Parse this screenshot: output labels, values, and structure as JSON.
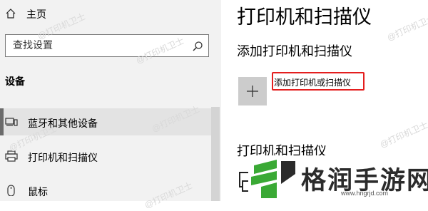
{
  "sidebar": {
    "home_label": "主页",
    "search_placeholder": "查找设置",
    "section_title": "设备",
    "items": [
      {
        "label": "蓝牙和其他设备",
        "icon": "bluetooth-devices-icon",
        "selected": true
      },
      {
        "label": "打印机和扫描仪",
        "icon": "printer-icon",
        "selected": false
      },
      {
        "label": "鼠标",
        "icon": "mouse-icon",
        "selected": false
      }
    ]
  },
  "main": {
    "page_title": "打印机和扫描仪",
    "add_section_title": "添加打印机和扫描仪",
    "add_button_label": "添加打印机或扫描仪",
    "printers_section_title": "打印机和扫描仪"
  },
  "watermark": "@打印机卫士",
  "logo": {
    "name": "格润手游网",
    "url": "www.hngrjd.com",
    "colors": {
      "green": "#3aa935",
      "dark": "#2b2b2b"
    }
  },
  "colors": {
    "highlight_box": "#e41e1e",
    "sidebar_bg": "#f2f2f2",
    "selected_bg": "#e3e3e3",
    "tile_bg": "#cccccc"
  }
}
